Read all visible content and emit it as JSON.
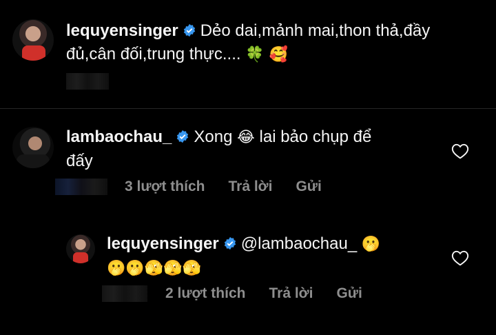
{
  "comments": [
    {
      "username": "lequyensinger",
      "text_line1": "Dẻo dai,mảnh mai,thon thả,đầy",
      "text_line2": "đủ,cân đối,trung thực....",
      "emojis": "🍀 🥰"
    },
    {
      "username": "lambaochau_",
      "text_line1_a": "Xong",
      "text_line1_emoji": "😂",
      "text_line1_b": "lai bảo chụp để",
      "text_line2": "đấy",
      "likes": "3 lượt thích",
      "reply": "Trả lời",
      "send": "Gửi"
    },
    {
      "username": "lequyensinger",
      "mention": "@lambaochau_",
      "mention_emoji": "🫢",
      "emojis_line2": "🫢🫢🫣🫣🫣",
      "likes": "2 lượt thích",
      "reply": "Trả lời",
      "send": "Gửi"
    }
  ],
  "colors": {
    "background": "#000000",
    "text": "#f5f5f5",
    "meta": "#8e8e8e",
    "verified": "#3897f0"
  },
  "icons": [
    "verified-icon",
    "heart-icon"
  ]
}
